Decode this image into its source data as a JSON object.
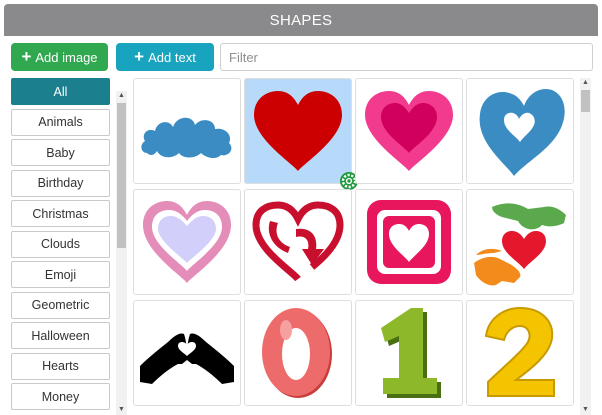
{
  "title": "SHAPES",
  "toolbar": {
    "add_image_label": "Add image",
    "add_text_label": "Add text",
    "filter_placeholder": "Filter"
  },
  "categories": [
    "All",
    "Animals",
    "Baby",
    "Birthday",
    "Christmas",
    "Clouds",
    "Emoji",
    "Geometric",
    "Halloween",
    "Hearts",
    "Money"
  ],
  "selected_category": "All",
  "colors": {
    "titlebar": "#8a8a8c",
    "add_image": "#2fa84f",
    "add_text": "#18a3bf",
    "active_category": "#1b7f8e",
    "selected_cell": "#b7dafa"
  },
  "shapes": [
    {
      "icon": "cloud-icon"
    },
    {
      "icon": "red-heart-icon",
      "selected": true
    },
    {
      "icon": "pink-layered-heart-icon"
    },
    {
      "icon": "blue-heart-icon"
    },
    {
      "icon": "pink-outline-heart-icon"
    },
    {
      "icon": "heart-arrow-icon"
    },
    {
      "icon": "heart-square-icon"
    },
    {
      "icon": "hands-holding-heart-icon"
    },
    {
      "icon": "hand-heart-gesture-icon"
    },
    {
      "icon": "number-zero-icon"
    },
    {
      "icon": "number-one-icon"
    },
    {
      "icon": "number-two-icon"
    }
  ]
}
